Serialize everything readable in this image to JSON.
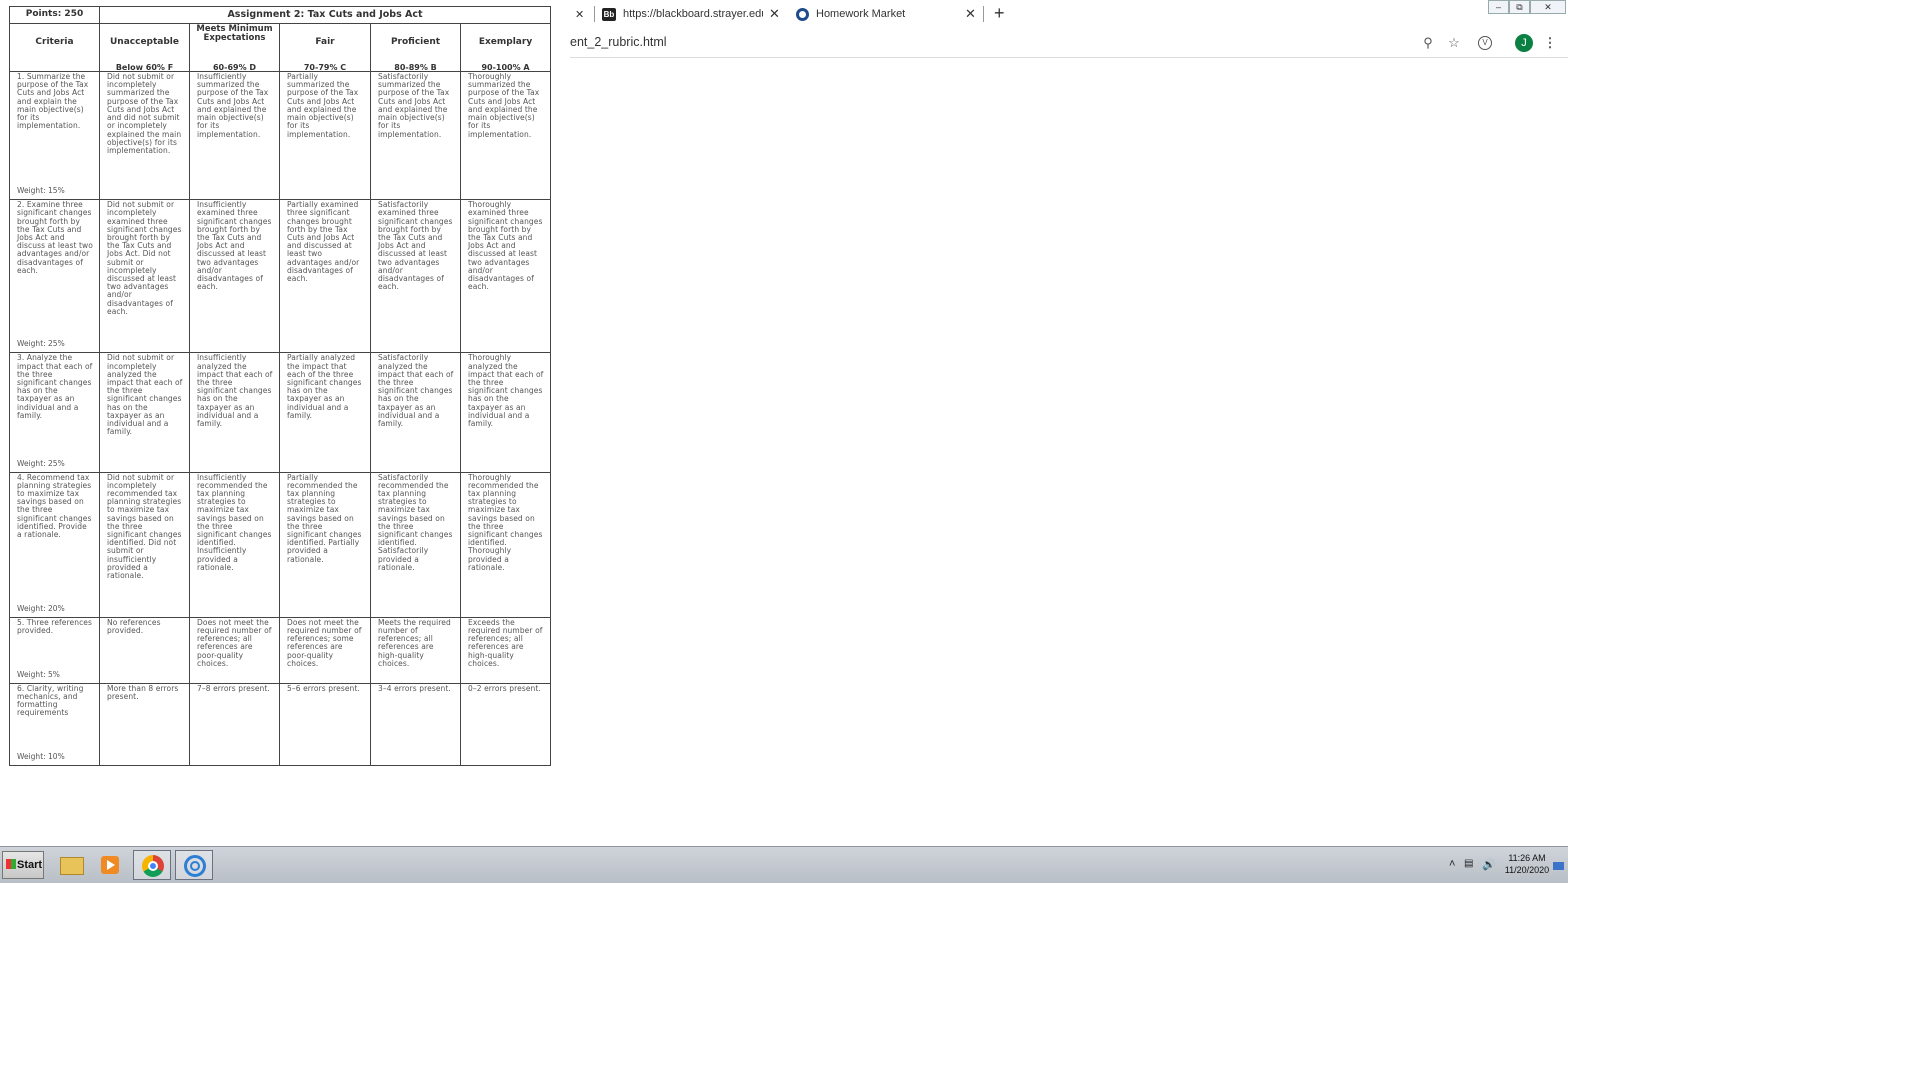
{
  "rubric": {
    "points": "Points: 250",
    "title": "Assignment 2: Tax Cuts and Jobs Act",
    "criteria_header": "Criteria",
    "levels": [
      {
        "label": "Unacceptable",
        "grade": "Below 60% F"
      },
      {
        "label": "Meets Minimum Expectations",
        "grade": "60-69% D"
      },
      {
        "label": "Fair",
        "grade": "70-79% C"
      },
      {
        "label": "Proficient",
        "grade": "80-89% B"
      },
      {
        "label": "Exemplary",
        "grade": "90-100% A"
      }
    ],
    "rows": [
      {
        "criterion": "1. Summarize the purpose of the Tax Cuts and Jobs Act and explain the main objective(s) for its implementation.",
        "weight": "Weight: 15%",
        "cells": [
          "Did not submit or incompletely summarized the purpose of the Tax Cuts and Jobs Act and did not submit or incompletely explained the main objective(s) for its implementation.",
          "Insufficiently summarized the purpose of the Tax Cuts and Jobs Act and explained the main objective(s) for its implementation.",
          "Partially summarized the purpose of the Tax Cuts and Jobs Act and explained the main objective(s) for its implementation.",
          "Satisfactorily summarized the purpose of the Tax Cuts and Jobs Act and explained the main objective(s) for its implementation.",
          "Thoroughly summarized the purpose of the Tax Cuts and Jobs Act and explained the main objective(s) for its implementation."
        ]
      },
      {
        "criterion": "2. Examine three significant changes brought forth by the Tax Cuts and Jobs Act and discuss at least two advantages and/or disadvantages of each.",
        "weight": "Weight: 25%",
        "cells": [
          "Did not submit or incompletely examined three significant changes brought forth by the Tax Cuts and Jobs Act. Did not submit or incompletely discussed at least two advantages and/or disadvantages of each.",
          "Insufficiently examined three significant changes brought forth by the Tax Cuts and Jobs Act and discussed at least two advantages and/or disadvantages of each.",
          "Partially examined three significant changes brought forth by the Tax Cuts and Jobs Act and discussed at least two advantages and/or disadvantages of each.",
          "Satisfactorily examined three significant changes brought forth by the Tax Cuts and Jobs Act and discussed at least two advantages and/or disadvantages of each.",
          "Thoroughly examined three significant changes brought forth by the Tax Cuts and Jobs Act and discussed at least two advantages and/or disadvantages of each."
        ]
      },
      {
        "criterion": "3. Analyze the impact that each of the three significant changes has on the taxpayer as an individual and a family.",
        "weight": "Weight: 25%",
        "cells": [
          "Did not submit or incompletely analyzed the impact that each of the three significant changes has on the taxpayer as an individual and a family.",
          "Insufficiently analyzed the impact that each of the three significant changes has on the taxpayer as an individual and a family.",
          "Partially analyzed the impact that each of the three significant changes has on the taxpayer as an individual and a family.",
          "Satisfactorily analyzed the impact that each of the three significant changes has on the taxpayer as an individual and a family.",
          "Thoroughly analyzed the impact that each of the three significant changes has on the taxpayer as an individual and a family."
        ]
      },
      {
        "criterion": "4. Recommend tax planning strategies to maximize tax savings based on the three significant changes identified. Provide a rationale.",
        "weight": "Weight: 20%",
        "cells": [
          "Did not submit or incompletely recommended tax planning strategies to maximize tax savings based on the three significant changes identified. Did not submit or insufficiently provided a rationale.",
          "Insufficiently recommended the tax planning strategies to maximize tax savings based on the three significant changes identified. Insufficiently provided a rationale.",
          "Partially recommended the tax planning strategies to maximize tax savings based on the three significant changes identified. Partially provided a rationale.",
          "Satisfactorily recommended the tax planning strategies to maximize tax savings based on the three significant changes identified. Satisfactorily provided a rationale.",
          "Thoroughly recommended the tax planning strategies to maximize tax savings based on the three significant changes identified. Thoroughly provided a rationale."
        ]
      },
      {
        "criterion": "5. Three references provided.",
        "weight": "Weight: 5%",
        "cells": [
          "No references provided.",
          "Does not meet the required number of references; all references are poor-quality choices.",
          "Does not meet the required number of references; some references are poor-quality choices.",
          "Meets the required number of references; all references are high-quality choices.",
          "Exceeds the required number of references; all references are high-quality choices."
        ]
      },
      {
        "criterion": "6. Clarity, writing mechanics, and formatting requirements",
        "weight": "Weight: 10%",
        "cells": [
          "More than 8 errors present.",
          "7–8 errors present.",
          "5–6 errors present.",
          "3–4 errors present.",
          "0–2 errors present."
        ]
      }
    ]
  },
  "browser": {
    "tabs": [
      {
        "label": "https://blackboard.strayer.edu/bbcs",
        "favicon": "blackboard-icon",
        "active": true
      },
      {
        "label": "Homework Market",
        "favicon": "homework-market-icon",
        "active": false
      }
    ],
    "favicon_bb_text": "Bb",
    "new_tab": "+",
    "close_glyph": "✕",
    "url": "ent_2_rubric.html",
    "avatar_initial": "J",
    "window_buttons": [
      "–",
      "⧉",
      "✕"
    ]
  },
  "taskbar": {
    "start_label": "Start",
    "apps": [
      "file-explorer-icon",
      "media-player-icon",
      "chrome-icon",
      "swirl-app-icon"
    ],
    "clock_time": "11:26 AM",
    "clock_date": "11/20/2020"
  }
}
